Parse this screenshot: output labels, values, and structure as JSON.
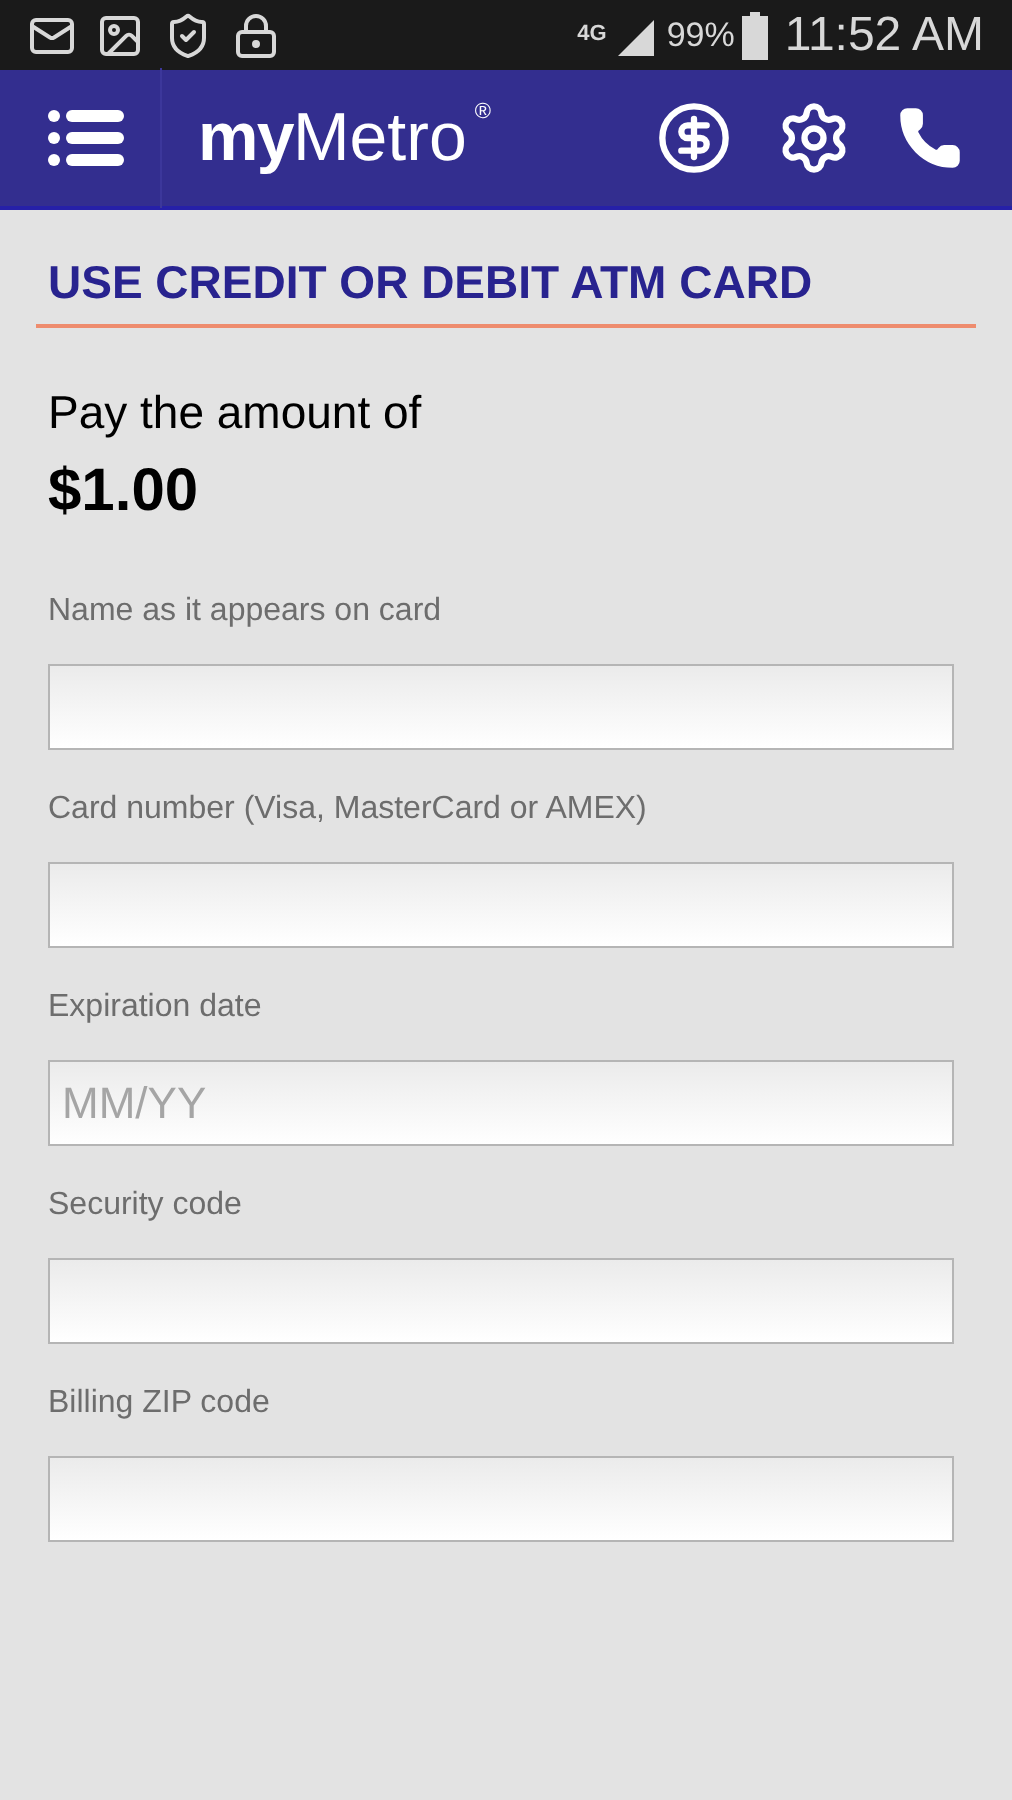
{
  "status_bar": {
    "signal_type": "4G",
    "battery": "99%",
    "time": "11:52 AM"
  },
  "header": {
    "logo_bold": "my",
    "logo_light": "Metro",
    "logo_mark": "®"
  },
  "title": "USE CREDIT OR DEBIT ATM CARD",
  "amount_label": "Pay the amount of",
  "amount": "$1.00",
  "fields": [
    {
      "label": "Name as it appears on card"
    },
    {
      "label": "Card number (Visa, MasterCard or AMEX)"
    },
    {
      "label": "Expiration date",
      "placeholder": "MM/YY"
    },
    {
      "label": "Security code"
    },
    {
      "label": "Billing ZIP code"
    }
  ]
}
